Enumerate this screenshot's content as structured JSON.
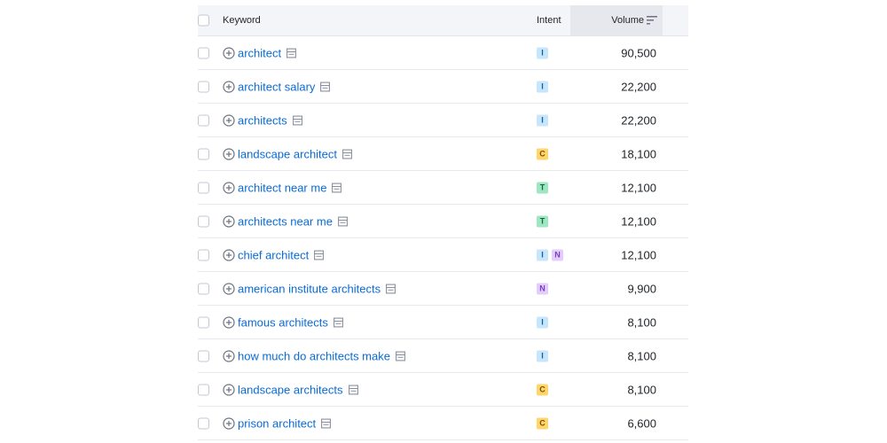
{
  "header": {
    "keyword_label": "Keyword",
    "intent_label": "Intent",
    "volume_label": "Volume"
  },
  "intent_colors": {
    "I": "#c7e6fb",
    "C": "#ffd66b",
    "T": "#9fe6c2",
    "N": "#e2cdfb"
  },
  "rows": [
    {
      "keyword": "architect",
      "intents": [
        "I"
      ],
      "volume": "90,500"
    },
    {
      "keyword": "architect salary",
      "intents": [
        "I"
      ],
      "volume": "22,200"
    },
    {
      "keyword": "architects",
      "intents": [
        "I"
      ],
      "volume": "22,200"
    },
    {
      "keyword": "landscape architect",
      "intents": [
        "C"
      ],
      "volume": "18,100"
    },
    {
      "keyword": "architect near me",
      "intents": [
        "T"
      ],
      "volume": "12,100"
    },
    {
      "keyword": "architects near me",
      "intents": [
        "T"
      ],
      "volume": "12,100"
    },
    {
      "keyword": "chief architect",
      "intents": [
        "I",
        "N"
      ],
      "volume": "12,100"
    },
    {
      "keyword": "american institute architects",
      "intents": [
        "N"
      ],
      "volume": "9,900"
    },
    {
      "keyword": "famous architects",
      "intents": [
        "I"
      ],
      "volume": "8,100"
    },
    {
      "keyword": "how much do architects make",
      "intents": [
        "I"
      ],
      "volume": "8,100"
    },
    {
      "keyword": "landscape architects",
      "intents": [
        "C"
      ],
      "volume": "8,100"
    },
    {
      "keyword": "prison architect",
      "intents": [
        "C"
      ],
      "volume": "6,600"
    }
  ]
}
